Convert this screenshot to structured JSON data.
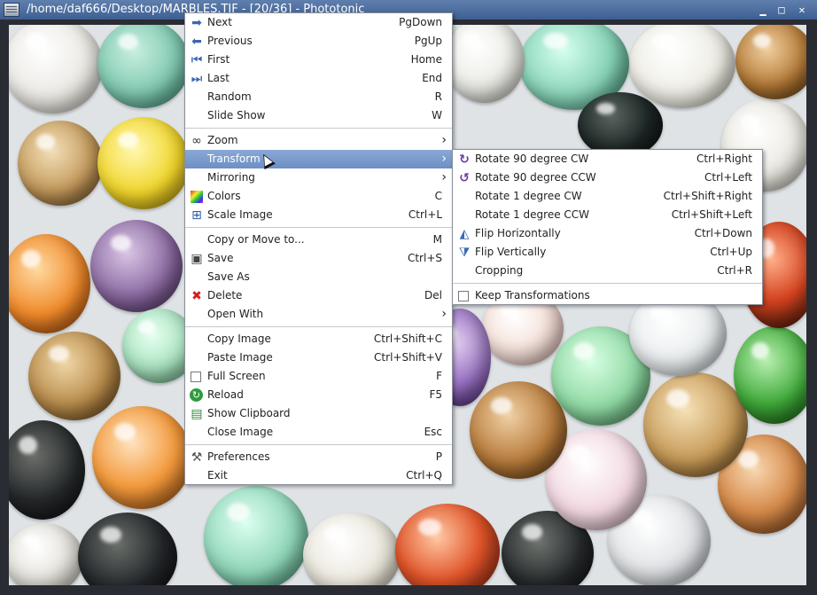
{
  "window": {
    "title": "/home/daf666/Desktop/MARBLES.TIF - [20/36] - Phototonic",
    "minimize": "▁",
    "maximize": "□",
    "close": "✕"
  },
  "menu": {
    "items": [
      {
        "label": "Next",
        "shortcut": "PgDown",
        "icon": "arrow-right-icon"
      },
      {
        "label": "Previous",
        "shortcut": "PgUp",
        "icon": "arrow-left-icon"
      },
      {
        "label": "First",
        "shortcut": "Home",
        "icon": "first-icon"
      },
      {
        "label": "Last",
        "shortcut": "End",
        "icon": "last-icon"
      },
      {
        "label": "Random",
        "shortcut": "R"
      },
      {
        "label": "Slide Show",
        "shortcut": "W"
      },
      {
        "label": "Zoom",
        "icon": "binoculars-icon"
      },
      {
        "label": "Transform"
      },
      {
        "label": "Mirroring"
      },
      {
        "label": "Colors",
        "shortcut": "C",
        "icon": "colors-icon"
      },
      {
        "label": "Scale Image",
        "shortcut": "Ctrl+L",
        "icon": "scale-icon"
      },
      {
        "label": "Copy or Move to...",
        "shortcut": "M"
      },
      {
        "label": "Save",
        "shortcut": "Ctrl+S",
        "icon": "floppy-icon"
      },
      {
        "label": "Save As"
      },
      {
        "label": "Delete",
        "shortcut": "Del",
        "icon": "delete-icon"
      },
      {
        "label": "Open With"
      },
      {
        "label": "Copy Image",
        "shortcut": "Ctrl+Shift+C"
      },
      {
        "label": "Paste Image",
        "shortcut": "Ctrl+Shift+V"
      },
      {
        "label": "Full Screen",
        "shortcut": "F"
      },
      {
        "label": "Reload",
        "shortcut": "F5",
        "icon": "reload-icon"
      },
      {
        "label": "Show Clipboard",
        "icon": "clipboard-icon"
      },
      {
        "label": "Close Image",
        "shortcut": "Esc"
      },
      {
        "label": "Preferences",
        "shortcut": "P",
        "icon": "tools-icon"
      },
      {
        "label": "Exit",
        "shortcut": "Ctrl+Q"
      }
    ]
  },
  "submenu": {
    "items": [
      {
        "label": "Rotate 90 degree CW",
        "shortcut": "Ctrl+Right",
        "icon": "rotate-cw-icon"
      },
      {
        "label": "Rotate 90 degree CCW",
        "shortcut": "Ctrl+Left",
        "icon": "rotate-ccw-icon"
      },
      {
        "label": "Rotate 1 degree CW",
        "shortcut": "Ctrl+Shift+Right"
      },
      {
        "label": "Rotate 1 degree CCW",
        "shortcut": "Ctrl+Shift+Left"
      },
      {
        "label": "Flip Horizontally",
        "shortcut": "Ctrl+Down",
        "icon": "flip-horizontal-icon"
      },
      {
        "label": "Flip Vertically",
        "shortcut": "Ctrl+Up",
        "icon": "flip-vertical-icon"
      },
      {
        "label": "Cropping",
        "shortcut": "Ctrl+R"
      },
      {
        "label": "Keep Transformations"
      }
    ]
  },
  "colors": {
    "highlight": "#7b9bcf",
    "titlebar": "#4a6a9c"
  }
}
